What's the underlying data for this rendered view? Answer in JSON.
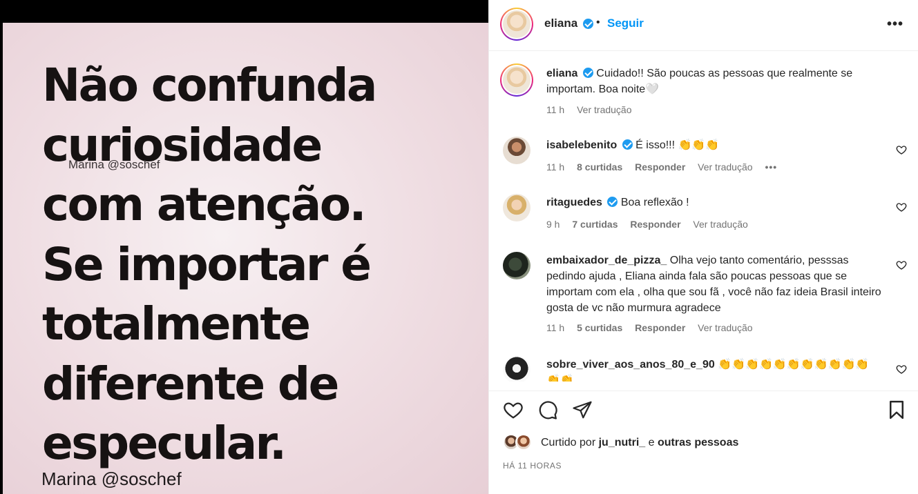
{
  "post": {
    "quote_text": "Não confunda\ncuriosidade\ncom atenção.\nSe importar é\ntotalmente\ndiferente de\nespecular.",
    "watermark_top": "Marina @soschef",
    "watermark_bottom": "Marina @soschef"
  },
  "header": {
    "username": "eliana",
    "dot": "•",
    "follow_label": "Seguir",
    "more_icon": "more-options-icon",
    "more_label": "•••"
  },
  "caption": {
    "username": "eliana",
    "text": "Cuidado!! São poucas as pessoas que realmente se importam. Boa noite🤍",
    "time": "11 h",
    "translate_label": "Ver tradução"
  },
  "comments": [
    {
      "username": "isabelebenito",
      "verified": true,
      "text": "É isso!!! 👏👏👏",
      "time": "11 h",
      "likes": "8 curtidas",
      "reply_label": "Responder",
      "translate_label": "Ver tradução",
      "more_label": "•••"
    },
    {
      "username": "ritaguedes",
      "verified": true,
      "text": "Boa reflexão !",
      "time": "9 h",
      "likes": "7 curtidas",
      "reply_label": "Responder",
      "translate_label": "Ver tradução"
    },
    {
      "username": "embaixador_de_pizza_",
      "verified": false,
      "text": "Olha vejo tanto comentário, pesssas pedindo ajuda , Eliana ainda fala são poucas pessoas que se importam com ela , olha que sou fã , você não faz ideia Brasil inteiro gosta de vc não murmura agradece",
      "time": "11 h",
      "likes": "5 curtidas",
      "reply_label": "Responder",
      "translate_label": "Ver tradução"
    },
    {
      "username": "sobre_viver_aos_anos_80_e_90",
      "verified": false,
      "text": "👏👏👏👏👏👏👏👏👏👏👏👏👏"
    }
  ],
  "actions": {
    "like_icon": "heart-icon",
    "comment_icon": "comment-icon",
    "share_icon": "share-icon",
    "save_icon": "bookmark-icon"
  },
  "likes": {
    "prefix": "Curtido por",
    "first_user": "ju_nutri_",
    "conjunction": "e",
    "others": "outras pessoas"
  },
  "post_time": "HÁ 11 HORAS",
  "colors": {
    "accent_blue": "#0095f6",
    "verified_blue": "#1d9bf0",
    "text_primary": "#262626",
    "text_secondary": "#737373",
    "image_background": "#efdde2"
  }
}
